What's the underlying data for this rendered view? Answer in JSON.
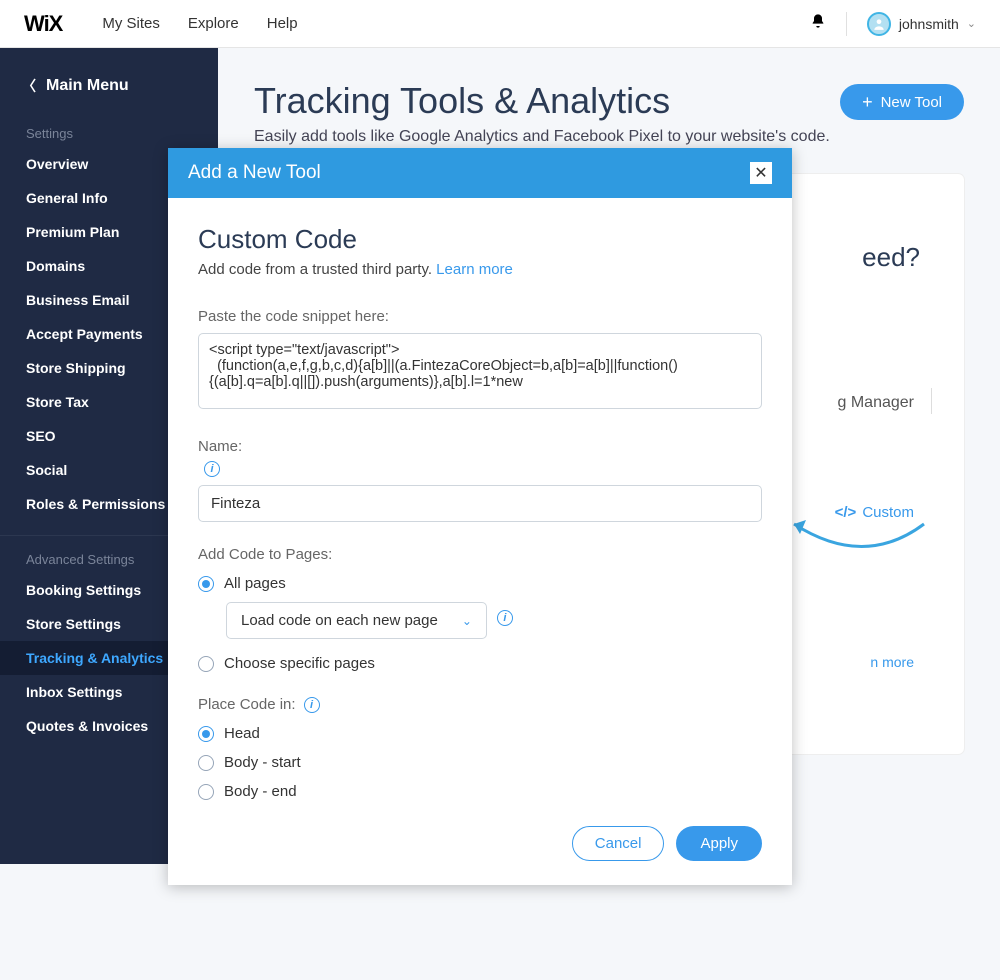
{
  "header": {
    "logo": "WiX",
    "nav": [
      "My Sites",
      "Explore",
      "Help"
    ],
    "username": "johnsmith"
  },
  "sidebar": {
    "back": "Main Menu",
    "section1_label": "Settings",
    "section1": [
      "Overview",
      "General Info",
      "Premium Plan",
      "Domains",
      "Business Email",
      "Accept Payments",
      "Store Shipping",
      "Store Tax",
      "SEO",
      "Social",
      "Roles & Permissions"
    ],
    "section2_label": "Advanced Settings",
    "section2": [
      "Booking Settings",
      "Store Settings",
      "Tracking & Analytics",
      "Inbox Settings",
      "Quotes & Invoices"
    ],
    "active": "Tracking & Analytics"
  },
  "page": {
    "title": "Tracking Tools & Analytics",
    "subtitle": "Easily add tools like Google Analytics and Facebook Pixel to your website's code.",
    "new_tool_btn": "New Tool",
    "card_question_suffix": "eed?",
    "tab_visible": "g Manager",
    "custom_label": "Custom",
    "learn_more": "n more"
  },
  "modal": {
    "header": "Add a New Tool",
    "title": "Custom Code",
    "subtitle_prefix": "Add code from a trusted third party. ",
    "learn_more": "Learn more",
    "code_label": "Paste the code snippet here:",
    "code_value": "<script type=\"text/javascript\">\n  (function(a,e,f,g,b,c,d){a[b]||(a.FintezaCoreObject=b,a[b]=a[b]||function(){(a[b].q=a[b].q||[]).push(arguments)},a[b].l=1*new",
    "name_label": "Name:",
    "name_value": "Finteza",
    "pages_label": "Add Code to Pages:",
    "pages_options": [
      "All pages",
      "Choose specific pages"
    ],
    "pages_select": "Load code on each new page",
    "place_label": "Place Code in:",
    "place_options": [
      "Head",
      "Body - start",
      "Body - end"
    ],
    "cancel": "Cancel",
    "apply": "Apply"
  }
}
